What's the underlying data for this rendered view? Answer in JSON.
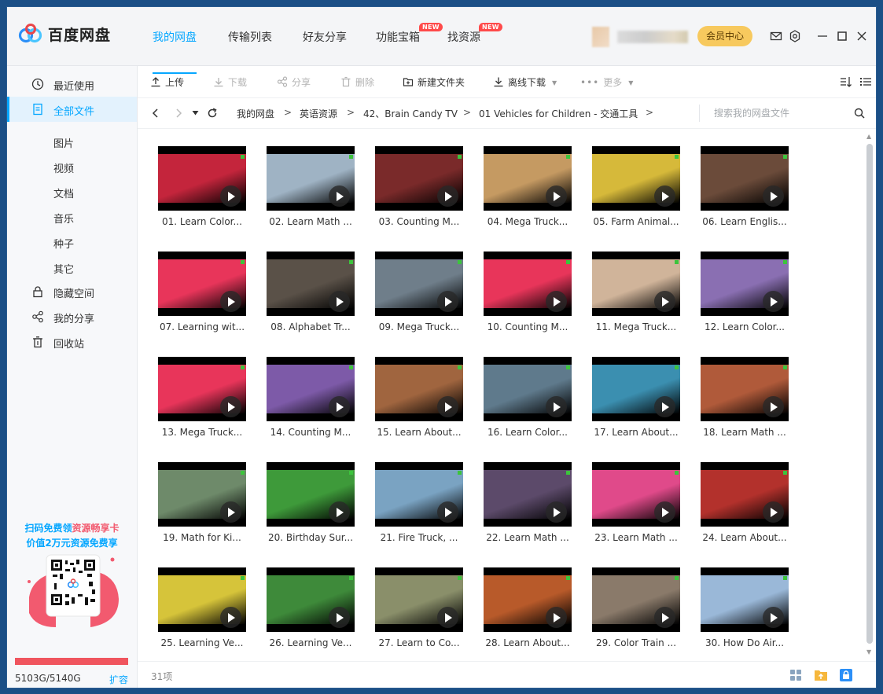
{
  "app": {
    "brand": "百度网盘",
    "vip_label": "会员中心"
  },
  "nav": [
    {
      "label": "我的网盘",
      "active": true
    },
    {
      "label": "传输列表"
    },
    {
      "label": "好友分享"
    },
    {
      "label": "功能宝箱",
      "badge": "NEW"
    },
    {
      "label": "找资源",
      "badge": "NEW"
    }
  ],
  "sidebar": {
    "items": [
      {
        "label": "最近使用",
        "icon": "clock-icon"
      },
      {
        "label": "全部文件",
        "icon": "file-icon",
        "active": true
      }
    ],
    "subitems": [
      "图片",
      "视频",
      "文档",
      "音乐",
      "种子",
      "其它"
    ],
    "bottom_items": [
      {
        "label": "隐藏空间",
        "icon": "lock-icon"
      },
      {
        "label": "我的分享",
        "icon": "share-icon"
      },
      {
        "label": "回收站",
        "icon": "trash-icon"
      }
    ],
    "promo_line1_a": "扫码免费领",
    "promo_line1_b": "资源畅享卡",
    "promo_line2": "价值2万元资源免费享",
    "storage": "5103G/5140G",
    "storage_used_fraction": 0.993,
    "expand": "扩容"
  },
  "toolbar": {
    "upload": "上传",
    "download": "下载",
    "share": "分享",
    "delete": "删除",
    "new_folder": "新建文件夹",
    "offline": "离线下载",
    "more": "更多"
  },
  "breadcrumb": [
    "我的网盘",
    "英语资源",
    "42、Brain Candy TV",
    "01 Vehicles for Children - 交通工具"
  ],
  "search": {
    "placeholder": "搜索我的网盘文件"
  },
  "files": [
    {
      "name": "01. Learn Color...",
      "bg": "#c4253c"
    },
    {
      "name": "02. Learn Math ...",
      "bg": "#9fb3c4"
    },
    {
      "name": "03. Counting M...",
      "bg": "#7a2a2a"
    },
    {
      "name": "04. Mega Truck...",
      "bg": "#c59a62"
    },
    {
      "name": "05. Farm Animal...",
      "bg": "#d6b93a"
    },
    {
      "name": "06. Learn Englis...",
      "bg": "#6b4b3a"
    },
    {
      "name": "07. Learning wit...",
      "bg": "#e8355a"
    },
    {
      "name": "08. Alphabet Tr...",
      "bg": "#5a5148"
    },
    {
      "name": "09. Mega Truck...",
      "bg": "#6f7e8a"
    },
    {
      "name": "10. Counting M...",
      "bg": "#e8355a"
    },
    {
      "name": "11. Mega Truck...",
      "bg": "#d0b49a"
    },
    {
      "name": "12. Learn Color...",
      "bg": "#8a6fb2"
    },
    {
      "name": "13. Mega Truck...",
      "bg": "#e8355a"
    },
    {
      "name": "14. Counting M...",
      "bg": "#7d5aa8"
    },
    {
      "name": "15. Learn About...",
      "bg": "#a0653f"
    },
    {
      "name": "16. Learn Color...",
      "bg": "#5f7a8c"
    },
    {
      "name": "17. Learn About...",
      "bg": "#3b8fb0"
    },
    {
      "name": "18. Learn Math ...",
      "bg": "#b05a3a"
    },
    {
      "name": "19. Math for Ki...",
      "bg": "#6e8a6a"
    },
    {
      "name": "20. Birthday Sur...",
      "bg": "#3e9a3a"
    },
    {
      "name": "21. Fire Truck, ...",
      "bg": "#7aa3c2"
    },
    {
      "name": "22. Learn Math ...",
      "bg": "#5c4a6a"
    },
    {
      "name": "23. Learn Math ...",
      "bg": "#e04a8a"
    },
    {
      "name": "24. Learn About...",
      "bg": "#b3312c"
    },
    {
      "name": "25. Learning Ve...",
      "bg": "#d6c43a"
    },
    {
      "name": "26. Learning Ve...",
      "bg": "#3e8a3a"
    },
    {
      "name": "27. Learn to Co...",
      "bg": "#8a8f6a"
    },
    {
      "name": "28. Learn About...",
      "bg": "#b85a2a"
    },
    {
      "name": "29. Color Train ...",
      "bg": "#8a7a6a"
    },
    {
      "name": "30. How Do Air...",
      "bg": "#9ab8d8"
    }
  ],
  "status": {
    "count": "31项"
  },
  "colors": {
    "accent": "#06a7ff",
    "vip": "#f7c95e",
    "badge": "#ff4a4a",
    "storage": "#f0555e"
  }
}
